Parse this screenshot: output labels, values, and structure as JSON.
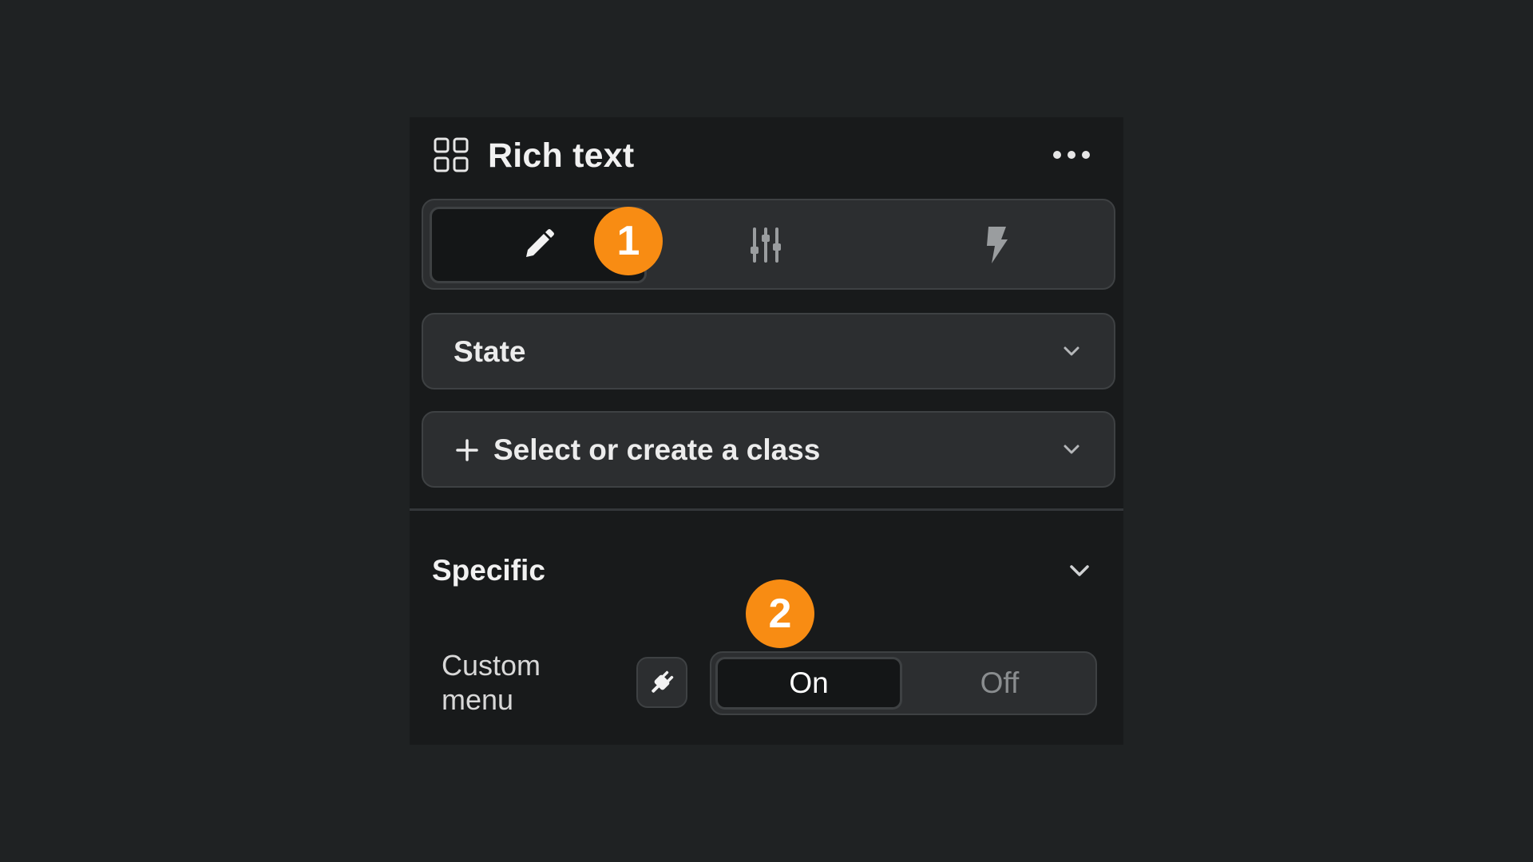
{
  "panel": {
    "title": "Rich text",
    "header_icon": "component-icon",
    "more_icon": "more-horizontal-icon"
  },
  "tabs": [
    {
      "name": "edit",
      "icon": "pencil-icon",
      "active": true
    },
    {
      "name": "settings",
      "icon": "sliders-icon",
      "active": false
    },
    {
      "name": "interactions",
      "icon": "lightning-icon",
      "active": false
    }
  ],
  "state_dropdown": {
    "label": "State",
    "icon": "chevron-down-icon"
  },
  "class_dropdown": {
    "label": "Select or create a class",
    "prefix_icon": "plus-icon",
    "icon": "chevron-down-icon"
  },
  "specific_section": {
    "title": "Specific",
    "icon": "chevron-down-icon",
    "custom_menu": {
      "label": "Custom menu",
      "plug_icon": "plug-icon",
      "options": [
        "On",
        "Off"
      ],
      "selected": "On"
    }
  },
  "annotations": [
    "1",
    "2"
  ],
  "colors": {
    "background": "#1f2223",
    "panel": "#181a1b",
    "control": "#2c2e30",
    "border": "#3e4143",
    "badge": "#f88c13"
  }
}
